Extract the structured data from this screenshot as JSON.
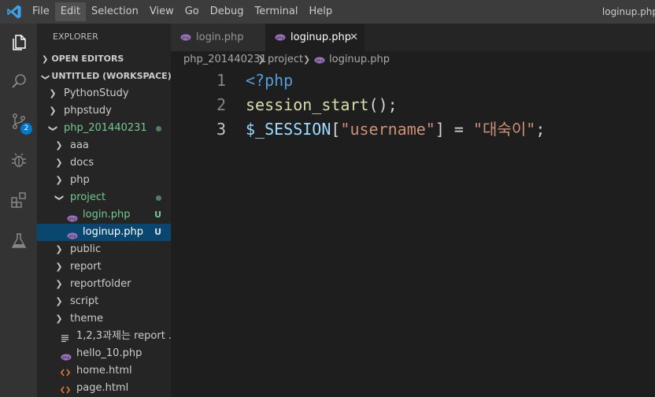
{
  "menu": [
    "File",
    "Edit",
    "Selection",
    "View",
    "Go",
    "Debug",
    "Terminal",
    "Help"
  ],
  "window_title": "loginup.php",
  "activity": {
    "scm_badge": "2"
  },
  "explorer": {
    "header": "EXPLORER",
    "open_editors": "OPEN EDITORS",
    "workspace": "UNTITLED (WORKSPACE)",
    "items": [
      {
        "label": "PythonStudy",
        "type": "folder",
        "state": "collapsed",
        "depth": 0
      },
      {
        "label": "phpstudy",
        "type": "folder",
        "state": "collapsed",
        "depth": 0
      },
      {
        "label": "php_201440231",
        "type": "folder",
        "state": "expanded",
        "depth": 0,
        "modified": true
      },
      {
        "label": "aaa",
        "type": "folder",
        "state": "collapsed",
        "depth": 1
      },
      {
        "label": "docs",
        "type": "folder",
        "state": "collapsed",
        "depth": 1
      },
      {
        "label": "php",
        "type": "folder",
        "state": "collapsed",
        "depth": 1
      },
      {
        "label": "project",
        "type": "folder",
        "state": "expanded",
        "depth": 1,
        "modified": true
      },
      {
        "label": "login.php",
        "type": "php",
        "depth": 2,
        "status": "U"
      },
      {
        "label": "loginup.php",
        "type": "php",
        "depth": 2,
        "status": "U",
        "selected": true
      },
      {
        "label": "public",
        "type": "folder",
        "state": "collapsed",
        "depth": 1
      },
      {
        "label": "report",
        "type": "folder",
        "state": "collapsed",
        "depth": 1
      },
      {
        "label": "reportfolder",
        "type": "folder",
        "state": "collapsed",
        "depth": 1
      },
      {
        "label": "script",
        "type": "folder",
        "state": "collapsed",
        "depth": 1
      },
      {
        "label": "theme",
        "type": "folder",
        "state": "collapsed",
        "depth": 1
      },
      {
        "label": "1,2,3과제는 report ...",
        "type": "text",
        "depth": 1
      },
      {
        "label": "hello_10.php",
        "type": "php",
        "depth": 1
      },
      {
        "label": "home.html",
        "type": "html",
        "depth": 1
      },
      {
        "label": "page.html",
        "type": "html",
        "depth": 1
      }
    ]
  },
  "tabs": [
    {
      "label": "login.php",
      "active": false
    },
    {
      "label": "loginup.php",
      "active": true
    }
  ],
  "breadcrumb": [
    "php_201440231",
    "project",
    "loginup.php"
  ],
  "code": [
    {
      "n": "1",
      "tokens": [
        {
          "t": "<?php",
          "c": "tag"
        }
      ]
    },
    {
      "n": "2",
      "tokens": [
        {
          "t": "session_start",
          "c": "fn"
        },
        {
          "t": "();",
          "c": "punc"
        }
      ]
    },
    {
      "n": "3",
      "current": true,
      "tokens": [
        {
          "t": "$_SESSION",
          "c": "var"
        },
        {
          "t": "[",
          "c": "punc"
        },
        {
          "t": "\"username\"",
          "c": "str"
        },
        {
          "t": "] = ",
          "c": "punc"
        },
        {
          "t": "\"대숙이\"",
          "c": "str"
        },
        {
          "t": ";",
          "c": "punc"
        }
      ]
    }
  ]
}
